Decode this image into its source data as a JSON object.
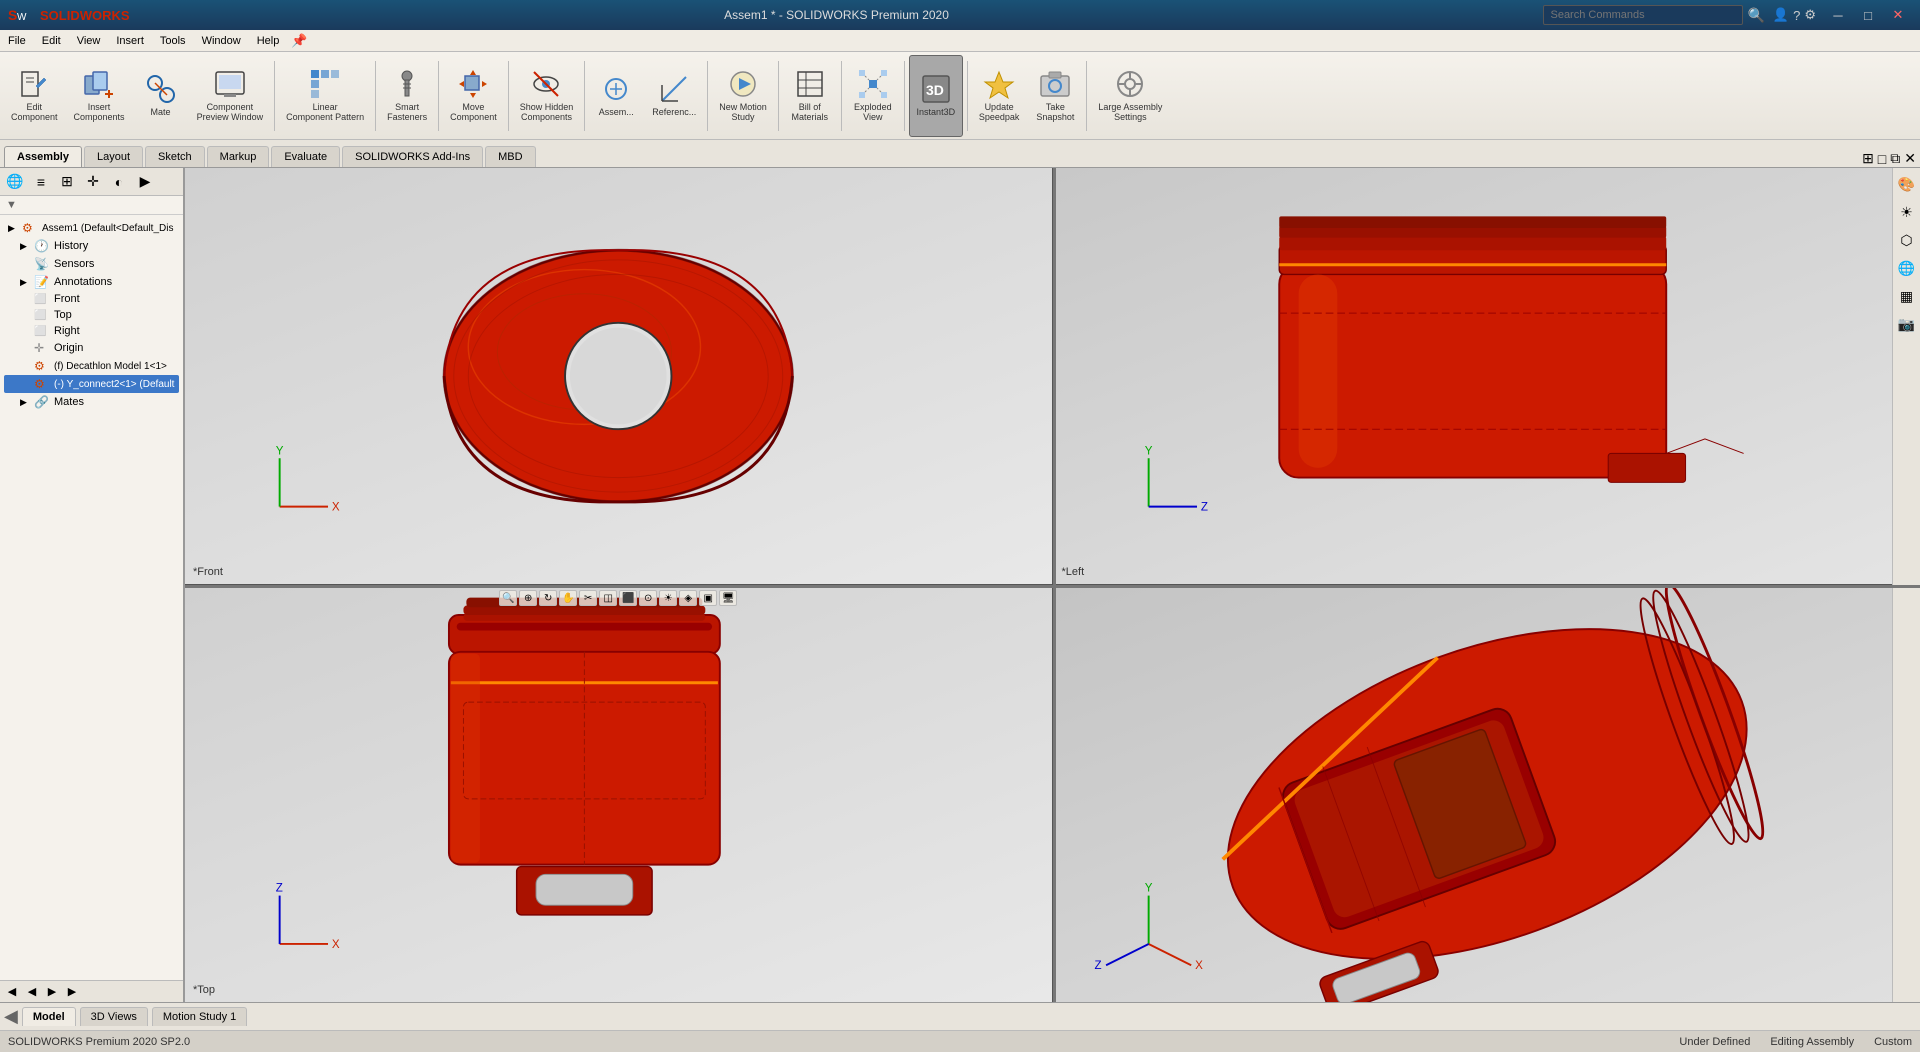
{
  "app": {
    "name": "SOLIDWORKS",
    "edition": "SOLIDWORKS Premium 2020 SP2.0",
    "title": "Assem1 *"
  },
  "titlebar": {
    "logo": "SW",
    "window_title": "Assem1 * - SOLIDWORKS Premium 2020",
    "controls": [
      "─",
      "□",
      "✕"
    ]
  },
  "menubar": {
    "items": [
      "File",
      "Edit",
      "View",
      "Insert",
      "Tools",
      "Window",
      "Help"
    ]
  },
  "search": {
    "placeholder": "Search Commands",
    "value": ""
  },
  "toolbar": {
    "tabs": [
      "Assembly",
      "Layout",
      "Sketch",
      "Markup",
      "Evaluate",
      "SOLIDWORKS Add-Ins",
      "MBD"
    ],
    "active_tab": "Assembly",
    "buttons": [
      {
        "id": "edit-component",
        "label": "Edit\nComponent",
        "icon": "✏️"
      },
      {
        "id": "insert-components",
        "label": "Insert\nComponents",
        "icon": "📦"
      },
      {
        "id": "mate",
        "label": "Mate",
        "icon": "🔗"
      },
      {
        "id": "component-preview",
        "label": "Component\nPreview Window",
        "icon": "👁"
      },
      {
        "id": "linear-pattern",
        "label": "Linear\nComponent Pattern",
        "icon": "⊞"
      },
      {
        "id": "smart-fasteners",
        "label": "Smart\nFasteners",
        "icon": "🔩"
      },
      {
        "id": "move-component",
        "label": "Move\nComponent",
        "icon": "↔"
      },
      {
        "id": "show-hidden",
        "label": "Show Hidden\nComponents",
        "icon": "🔍"
      },
      {
        "id": "assem",
        "label": "Assem...",
        "icon": "🔧"
      },
      {
        "id": "reference",
        "label": "Referenc...",
        "icon": "📐"
      },
      {
        "id": "new-motion",
        "label": "New Motion\nStudy",
        "icon": "▶"
      },
      {
        "id": "bill-of-materials",
        "label": "Bill of\nMaterials",
        "icon": "📋"
      },
      {
        "id": "exploded-view",
        "label": "Exploded\nView",
        "icon": "💥"
      },
      {
        "id": "instant3d",
        "label": "Instant3D",
        "icon": "3D"
      },
      {
        "id": "update-speedpak",
        "label": "Update\nSpeedpak",
        "icon": "⚡"
      },
      {
        "id": "take-snapshot",
        "label": "Take\nSnapshot",
        "icon": "📷"
      },
      {
        "id": "large-assembly",
        "label": "Large Assembly\nSettings",
        "icon": "⚙"
      }
    ]
  },
  "sidebar": {
    "tools": [
      "🌐",
      "≡",
      "↑",
      "✛",
      "◐",
      "▶"
    ],
    "filter_icon": "▼",
    "tree": [
      {
        "id": "root",
        "label": "Assem1 (Default<Default_Dis",
        "icon": "⚙",
        "indent": 0,
        "expand": "▶"
      },
      {
        "id": "history",
        "label": "History",
        "icon": "🕐",
        "indent": 1,
        "expand": "▶"
      },
      {
        "id": "sensors",
        "label": "Sensors",
        "icon": "📡",
        "indent": 1
      },
      {
        "id": "annotations",
        "label": "Annotations",
        "icon": "📝",
        "indent": 1,
        "expand": "▶"
      },
      {
        "id": "front",
        "label": "Front",
        "icon": "□",
        "indent": 1
      },
      {
        "id": "top",
        "label": "Top",
        "icon": "□",
        "indent": 1
      },
      {
        "id": "right",
        "label": "Right",
        "icon": "□",
        "indent": 1
      },
      {
        "id": "origin",
        "label": "Origin",
        "icon": "✛",
        "indent": 1
      },
      {
        "id": "decathlon",
        "label": "(f) Decathlon Model 1<1>",
        "icon": "⚙",
        "indent": 1,
        "selected": false
      },
      {
        "id": "yconnect",
        "label": "(-) Y_connect2<1> (Default",
        "icon": "⚙",
        "indent": 1,
        "selected": true
      },
      {
        "id": "mates",
        "label": "Mates",
        "icon": "🔗",
        "indent": 1,
        "expand": "▶"
      }
    ]
  },
  "viewports": [
    {
      "id": "front",
      "label": "*Front",
      "position": "top-left"
    },
    {
      "id": "left",
      "label": "*Left",
      "position": "top-right"
    },
    {
      "id": "top",
      "label": "*Top",
      "position": "bottom-left"
    },
    {
      "id": "isometric",
      "label": "",
      "position": "bottom-right"
    }
  ],
  "bottomtabs": [
    {
      "id": "model",
      "label": "Model",
      "active": true
    },
    {
      "id": "3dviews",
      "label": "3D Views"
    },
    {
      "id": "motion-study",
      "label": "Motion Study 1"
    }
  ],
  "statusbar": {
    "edition": "SOLIDWORKS Premium 2020 SP2.0",
    "status": "Under Defined",
    "context": "Editing Assembly",
    "custom": "Custom"
  }
}
